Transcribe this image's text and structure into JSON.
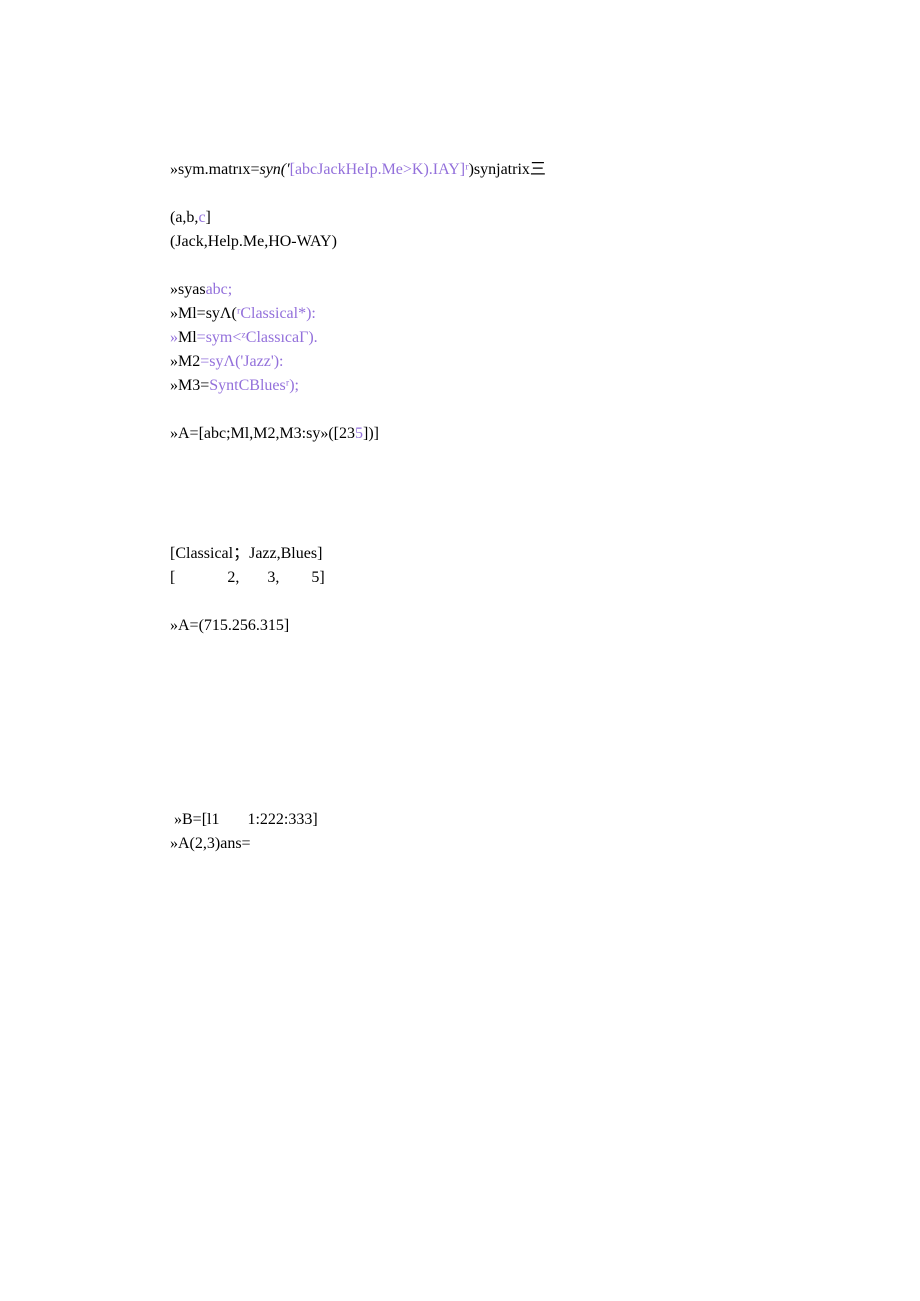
{
  "lines": {
    "l1_a": "»sym.matrıx=",
    "l1_b": "syn(′",
    "l1_c": "[abcJackHeIp.Me>K).IAY]ʳ",
    "l1_d": ")synjatrix三",
    "l2": "(a,b,",
    "l2b": "c",
    "l2c": "]",
    "l3": "(Jack,Help.Me,HO-WAY)",
    "l4a": "»",
    "l4b": "syas",
    "l4c": "abc;",
    "l5a": "»",
    "l5b": "Ml=syΛ(",
    "l5c": "ʳClassical*):",
    "l6a": "»",
    "l6b": "Ml",
    "l6c": "=sym<ᶻClassıcaΓ).",
    "l7a": "»",
    "l7b": "M2",
    "l7c": "=syΛ('Jazz'):",
    "l8a": "»",
    "l8b": "M3=",
    "l8c": "SyntCBluesʳ);",
    "l9a": "»",
    "l9b": "A=[abc;Ml,M2,M3:sy»([23",
    "l9c": "5",
    "l9d": "])]",
    "l10": "[Classical；Jazz,Blues]",
    "l11": "[             2,       3,        5]",
    "l12a": "»",
    "l12b": "A=(715.256.315]",
    "l13a": " »",
    "l13b": "B=[l1       1:222:333]",
    "l14a": "»",
    "l14b": "A(2,3)ans="
  }
}
